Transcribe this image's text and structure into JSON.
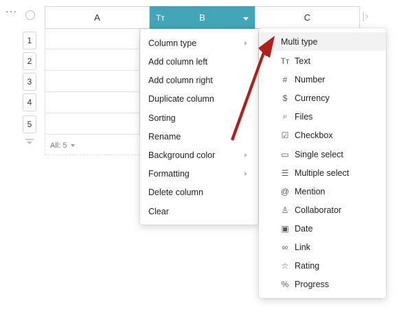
{
  "grid": {
    "top_controls": {
      "more": "···"
    },
    "columns": [
      {
        "label": "A"
      },
      {
        "label": "B",
        "type_icon": "Tт"
      },
      {
        "label": "C"
      }
    ],
    "row_numbers": [
      "1",
      "2",
      "3",
      "4",
      "5"
    ],
    "footer": {
      "count_text": "All: 5"
    }
  },
  "column_menu": {
    "items": [
      {
        "label": "Column type",
        "has_submenu": true
      },
      {
        "label": "Add column left"
      },
      {
        "label": "Add column right"
      },
      {
        "label": "Duplicate column"
      },
      {
        "label": "Sorting"
      },
      {
        "label": "Rename"
      },
      {
        "label": "Background color",
        "has_submenu": true
      },
      {
        "label": "Formatting",
        "has_submenu": true
      },
      {
        "label": "Delete column"
      },
      {
        "label": "Clear"
      }
    ]
  },
  "type_menu": {
    "items": [
      {
        "label": "Multi type"
      },
      {
        "label": "Text",
        "icon": "text-icon",
        "glyph": "Tт"
      },
      {
        "label": "Number",
        "icon": "hash-icon",
        "glyph": "#"
      },
      {
        "label": "Currency",
        "icon": "dollar-icon",
        "glyph": "$"
      },
      {
        "label": "Files",
        "icon": "paperclip-icon",
        "glyph": "⌕"
      },
      {
        "label": "Checkbox",
        "icon": "checkbox-icon",
        "glyph": "☑"
      },
      {
        "label": "Single select",
        "icon": "single-select-icon",
        "glyph": "▭"
      },
      {
        "label": "Multiple select",
        "icon": "multiple-select-icon",
        "glyph": "☰"
      },
      {
        "label": "Mention",
        "icon": "at-icon",
        "glyph": "@"
      },
      {
        "label": "Collaborator",
        "icon": "person-icon",
        "glyph": "♙"
      },
      {
        "label": "Date",
        "icon": "calendar-icon",
        "glyph": "▣"
      },
      {
        "label": "Link",
        "icon": "link-icon",
        "glyph": "∞"
      },
      {
        "label": "Rating",
        "icon": "star-icon",
        "glyph": "☆"
      },
      {
        "label": "Progress",
        "icon": "percent-icon",
        "glyph": "%"
      }
    ]
  },
  "colors": {
    "active_header": "#42a5b8",
    "arrow": "#b01f1a"
  }
}
